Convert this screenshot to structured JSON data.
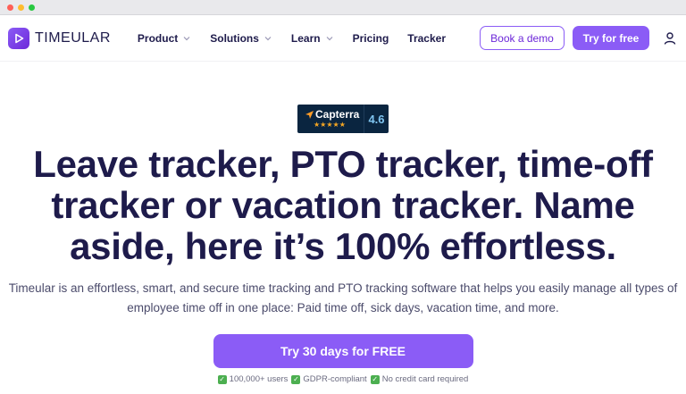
{
  "window": {
    "controls": [
      "close",
      "minimize",
      "maximize"
    ]
  },
  "nav": {
    "logo_text": "TIMEULAR",
    "logo_icon": "timeular-play-icon",
    "items": [
      {
        "label": "Product",
        "has_dropdown": true
      },
      {
        "label": "Solutions",
        "has_dropdown": true
      },
      {
        "label": "Learn",
        "has_dropdown": true
      },
      {
        "label": "Pricing",
        "has_dropdown": false
      },
      {
        "label": "Tracker",
        "has_dropdown": false
      }
    ],
    "book_demo_label": "Book a demo",
    "try_free_label": "Try for free",
    "account_icon": "user-icon"
  },
  "capterra": {
    "name": "Capterra",
    "stars": "★★★★★",
    "score": "4.6"
  },
  "hero": {
    "headline": "Leave tracker, PTO tracker, time-off tracker or vacation tracker. Name aside, here it’s 100% effortless.",
    "subtext": "Timeular is an effortless, smart, and secure time tracking and PTO tracking software that helps you easily manage all types of employee time off in one place: Paid time off, sick days, vacation time, and more.",
    "cta_label": "Try 30 days for FREE",
    "badges": [
      "100,000+ users",
      "GDPR-compliant",
      "No credit card required"
    ]
  },
  "colors": {
    "accent": "#8b5cf6",
    "text_dark": "#1e1b4b",
    "capterra_bg": "#0a2540",
    "check_green": "#4caf50"
  }
}
